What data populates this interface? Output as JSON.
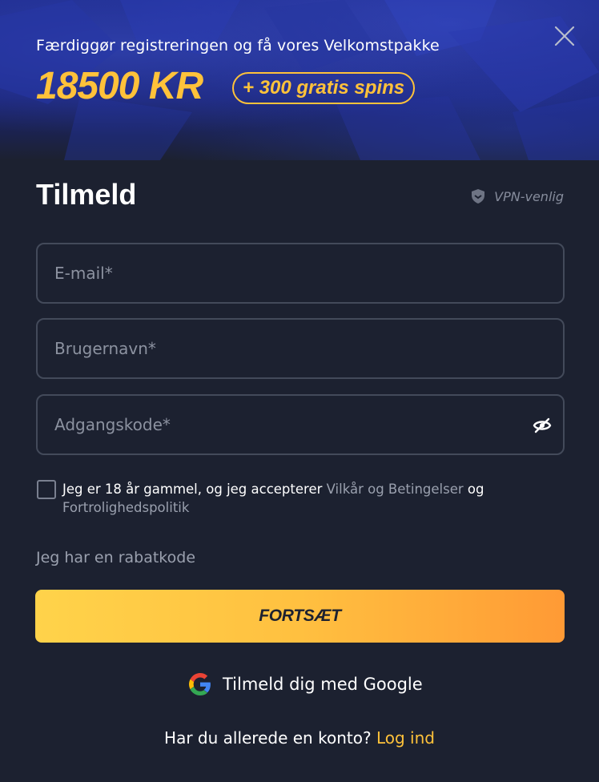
{
  "hero": {
    "subtitle": "Færdiggør registreringen og få vores Velkomstpakke",
    "amount": "18500 KR",
    "badge": "+ 300 gratis spins"
  },
  "form": {
    "title": "Tilmeld",
    "vpn_label": "VPN-venlig",
    "email_placeholder": "E-mail*",
    "username_placeholder": "Brugernavn*",
    "password_placeholder": "Adgangskode*",
    "terms_prefix": "Jeg er 18 år gammel, og jeg accepterer ",
    "terms_link": "Vilkår og Betingelser",
    "terms_and": " og",
    "privacy_link": "Fortrolighedspolitik",
    "promo_label": "Jeg har en rabatkode",
    "submit_label": "FORTSÆT",
    "google_label": "Tilmeld dig med Google",
    "login_prompt": "Har du allerede en konto? ",
    "login_link": "Log ind"
  },
  "colors": {
    "accent": "#ffc23a",
    "background": "#1c2130",
    "border": "#434a5a"
  }
}
